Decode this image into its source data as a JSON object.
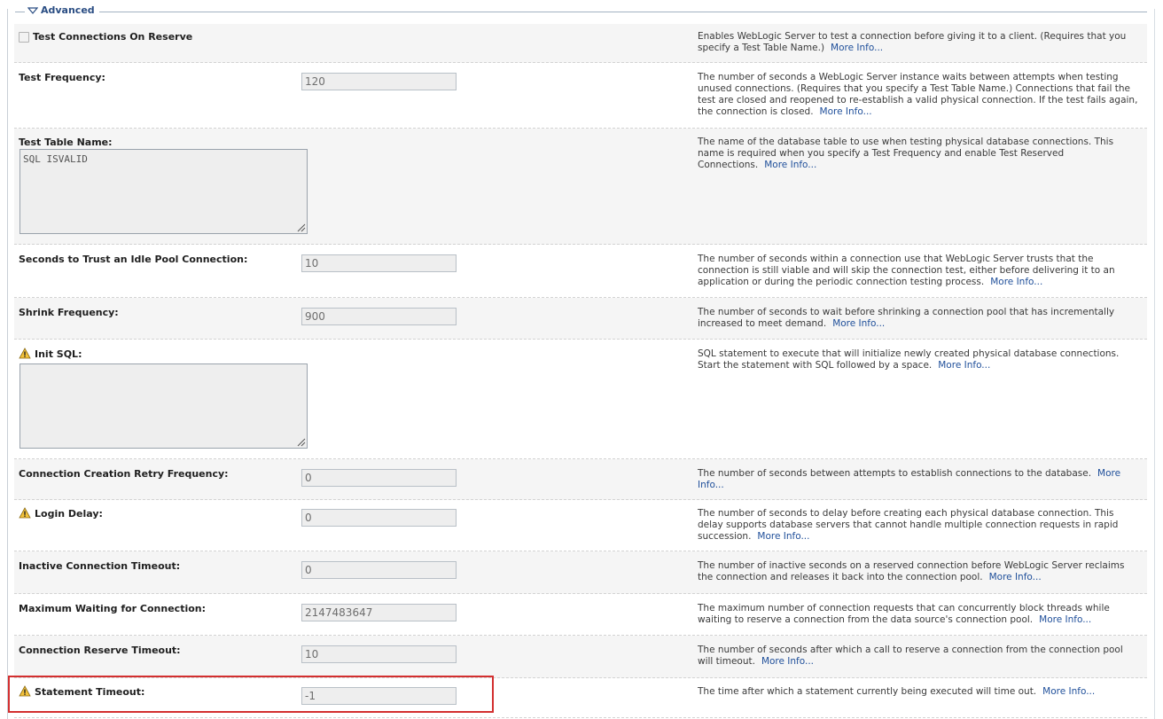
{
  "section": {
    "title": "Advanced"
  },
  "more_info": "More Info...",
  "rows": [
    {
      "label": "Test Connections On Reserve",
      "description": "Enables WebLogic Server to test a connection before giving it to a client. (Requires that you specify a Test Table Name.)"
    },
    {
      "label": "Test Frequency:",
      "value": "120",
      "description": "The number of seconds a WebLogic Server instance waits between attempts when testing unused connections. (Requires that you specify a Test Table Name.) Connections that fail the test are closed and reopened to re-establish a valid physical connection. If the test fails again, the connection is closed."
    },
    {
      "label": "Test Table Name:",
      "value": "SQL ISVALID",
      "description": "The name of the database table to use when testing physical database connections. This name is required when you specify a Test Frequency and enable Test Reserved Connections."
    },
    {
      "label": "Seconds to Trust an Idle Pool Connection:",
      "value": "10",
      "description": "The number of seconds within a connection use that WebLogic Server trusts that the connection is still viable and will skip the connection test, either before delivering it to an application or during the periodic connection testing process."
    },
    {
      "label": "Shrink Frequency:",
      "value": "900",
      "description": "The number of seconds to wait before shrinking a connection pool that has incrementally increased to meet demand."
    },
    {
      "label": "Init SQL:",
      "value": "",
      "description": "SQL statement to execute that will initialize newly created physical database connections. Start the statement with SQL followed by a space."
    },
    {
      "label": "Connection Creation Retry Frequency:",
      "value": "0",
      "description": "The number of seconds between attempts to establish connections to the database."
    },
    {
      "label": "Login Delay:",
      "value": "0",
      "description": "The number of seconds to delay before creating each physical database connection. This delay supports database servers that cannot handle multiple connection requests in rapid succession."
    },
    {
      "label": "Inactive Connection Timeout:",
      "value": "0",
      "description": "The number of inactive seconds on a reserved connection before WebLogic Server reclaims the connection and releases it back into the connection pool."
    },
    {
      "label": "Maximum Waiting for Connection:",
      "value": "2147483647",
      "description": "The maximum number of connection requests that can concurrently block threads while waiting to reserve a connection from the data source's connection pool."
    },
    {
      "label": "Connection Reserve Timeout:",
      "value": "10",
      "description": "The number of seconds after which a call to reserve a connection from the connection pool will timeout."
    },
    {
      "label": "Statement Timeout:",
      "value": "-1",
      "description": "The time after which a statement currently being executed will time out."
    }
  ],
  "colors": {
    "highlight": "#d32f2f",
    "link": "#1f4f9a",
    "legend": "#2a4d83"
  },
  "icons": {
    "legend": "chevron-down-icon",
    "warning": "warning-icon",
    "resize": "resize-grip-icon"
  }
}
